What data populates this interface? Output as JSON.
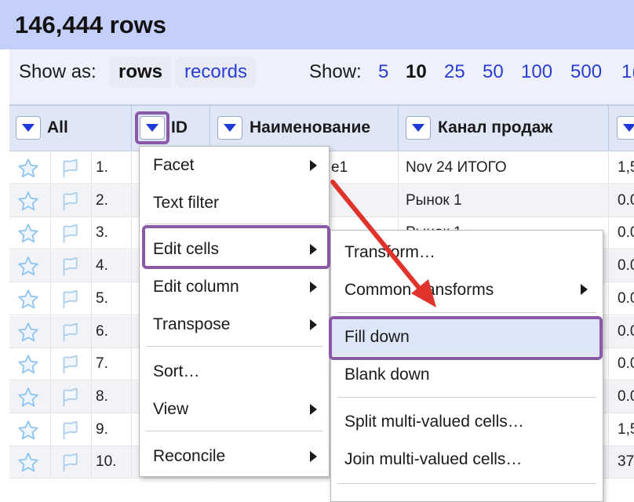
{
  "header": {
    "title": "146,444 rows"
  },
  "toolbar": {
    "show_as_label": "Show as:",
    "mode_rows": "rows",
    "mode_records": "records",
    "show_label": "Show:",
    "page_sizes": [
      "5",
      "10",
      "25",
      "50",
      "100",
      "500",
      "1("
    ],
    "selected_page_size": "10"
  },
  "columns": {
    "all": "All",
    "id": "ID",
    "name": "Наименование",
    "channel": "Канал продаж"
  },
  "rows": [
    {
      "num": "1.",
      "partial": "e1",
      "channel": "Nov 24 ИТОГО",
      "value": "1,5"
    },
    {
      "num": "2.",
      "partial": "",
      "channel": "Рынок 1",
      "value": "0.0"
    },
    {
      "num": "3.",
      "partial": "",
      "channel": "Рынок 1",
      "value": "0.0"
    },
    {
      "num": "4.",
      "partial": "",
      "channel": "",
      "value": "0.0"
    },
    {
      "num": "5.",
      "partial": "",
      "channel": "",
      "value": "0.0"
    },
    {
      "num": "6.",
      "partial": "",
      "channel": "",
      "value": "0.0"
    },
    {
      "num": "7.",
      "partial": "",
      "channel": "",
      "value": "0.0"
    },
    {
      "num": "8.",
      "partial": "",
      "channel": "",
      "value": "0.0"
    },
    {
      "num": "9.",
      "partial": "",
      "channel": "",
      "value": "1,5"
    },
    {
      "num": "10.",
      "partial": "",
      "channel": "",
      "value": "37"
    }
  ],
  "column_menu": {
    "items": [
      "Facet",
      "Text filter",
      "Edit cells",
      "Edit column",
      "Transpose",
      "Sort…",
      "View",
      "Reconcile"
    ]
  },
  "edit_cells_menu": {
    "items": [
      "Transform…",
      "Common transforms",
      "Fill down",
      "Blank down",
      "Split multi-valued cells…",
      "Join multi-valued cells…"
    ]
  },
  "colors": {
    "header_bg": "#c4cffa",
    "link_blue": "#2a3dd1",
    "highlight_outline": "#8a5aa8",
    "selected_item_bg": "#dde6f6",
    "annotation_arrow": "#e0332b"
  }
}
